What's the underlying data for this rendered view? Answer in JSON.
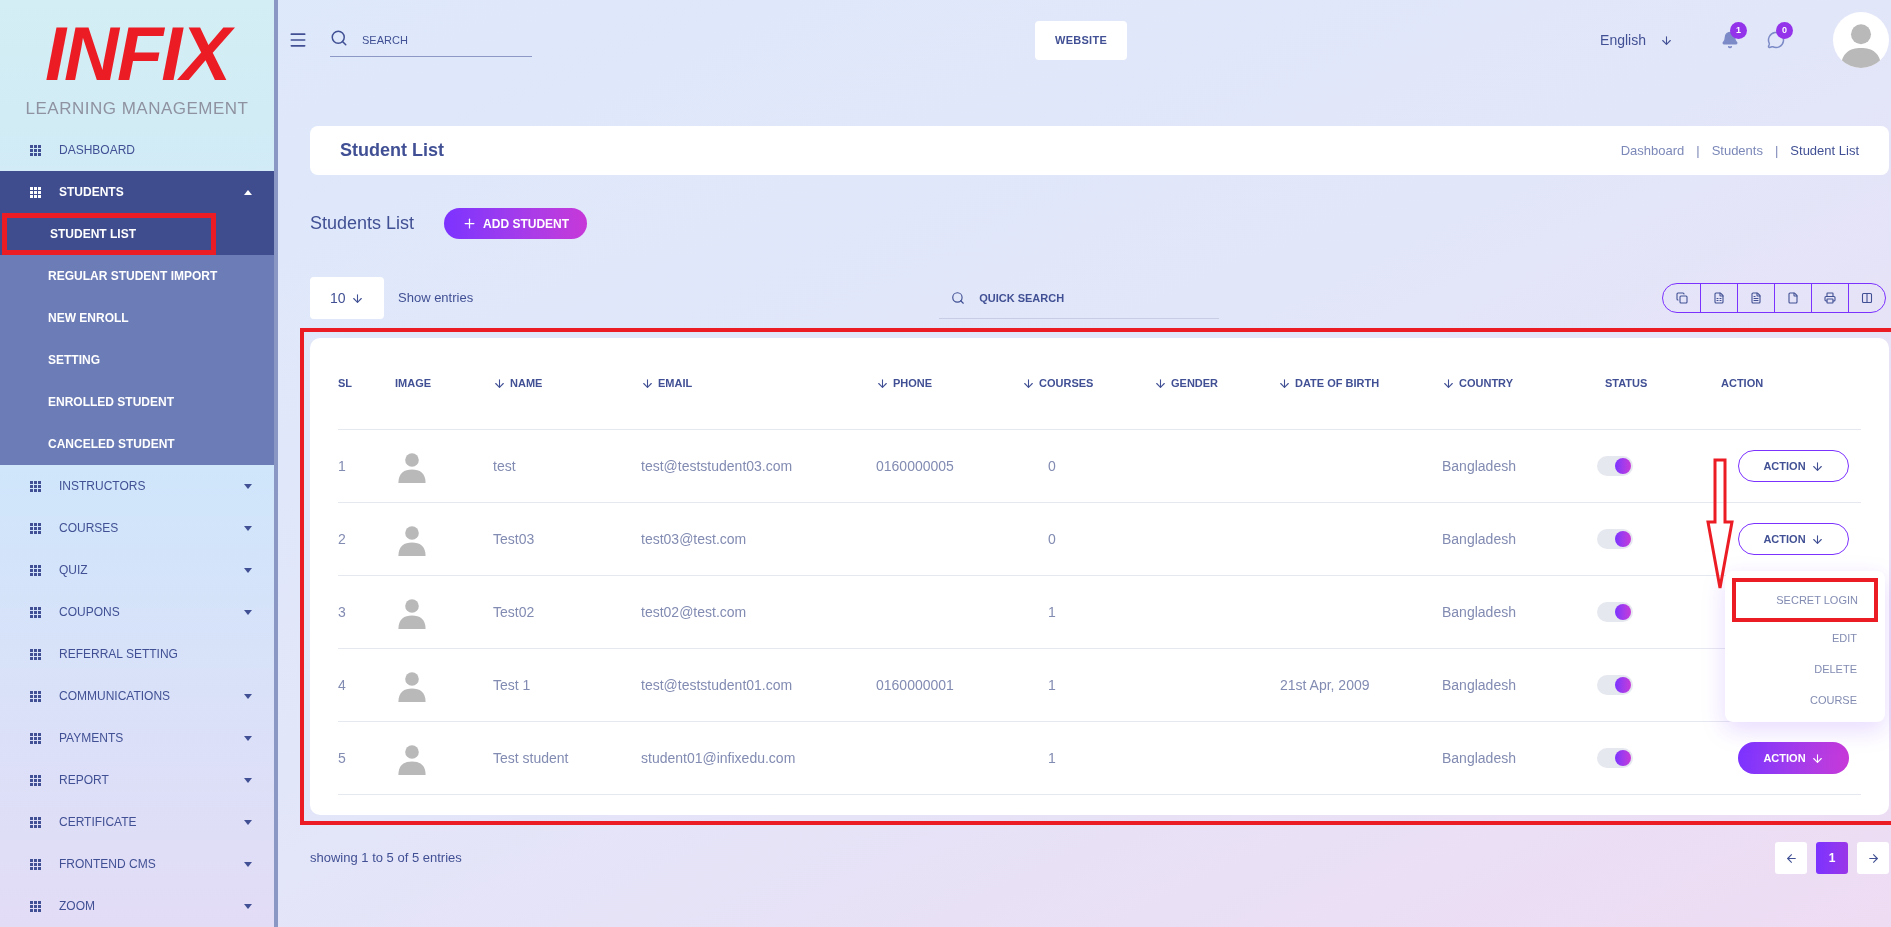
{
  "sidebar": {
    "logo": {
      "word": "INFIX",
      "subtitle": "LEARNING MANAGEMENT"
    },
    "items": [
      {
        "label": "DASHBOARD",
        "selected": false
      },
      {
        "label": "STUDENTS",
        "selected": true,
        "expanded": true,
        "children": [
          {
            "label": "STUDENT LIST",
            "selected": true
          },
          {
            "label": "REGULAR STUDENT IMPORT",
            "selected": false
          },
          {
            "label": "NEW ENROLL",
            "selected": false
          },
          {
            "label": "SETTING",
            "selected": false
          },
          {
            "label": "ENROLLED STUDENT",
            "selected": false
          },
          {
            "label": "CANCELED STUDENT",
            "selected": false
          }
        ]
      },
      {
        "label": "INSTRUCTORS",
        "selected": false,
        "expanded": false
      },
      {
        "label": "COURSES",
        "selected": false,
        "expanded": false
      },
      {
        "label": "QUIZ",
        "selected": false,
        "expanded": false
      },
      {
        "label": "COUPONS",
        "selected": false,
        "expanded": false
      },
      {
        "label": "REFERRAL SETTING",
        "selected": false
      },
      {
        "label": "COMMUNICATIONS",
        "selected": false,
        "expanded": false
      },
      {
        "label": "PAYMENTS",
        "selected": false,
        "expanded": false
      },
      {
        "label": "REPORT",
        "selected": false,
        "expanded": false
      },
      {
        "label": "CERTIFICATE",
        "selected": false,
        "expanded": false
      },
      {
        "label": "FRONTEND CMS",
        "selected": false,
        "expanded": false
      },
      {
        "label": "ZOOM",
        "selected": false,
        "expanded": false
      }
    ]
  },
  "topbar": {
    "search": {
      "placeholder": "SEARCH"
    },
    "website_button": "WEBSITE",
    "language": "English",
    "notifications": {
      "count": "1"
    },
    "messages": {
      "count": "0"
    }
  },
  "page_header": {
    "title": "Student List",
    "breadcrumb": [
      "Dashboard",
      "Students",
      "Student List"
    ],
    "separator": "|"
  },
  "section": {
    "title": "Students List",
    "add_button": "ADD STUDENT"
  },
  "controls": {
    "entries": "10",
    "entries_label": "Show entries",
    "quick_search": {
      "placeholder": "QUICK SEARCH"
    }
  },
  "table": {
    "columns": [
      {
        "label": "SL",
        "sortable": false
      },
      {
        "label": "IMAGE",
        "sortable": false
      },
      {
        "label": "NAME",
        "sortable": true
      },
      {
        "label": "EMAIL",
        "sortable": true
      },
      {
        "label": "PHONE",
        "sortable": true
      },
      {
        "label": "COURSES",
        "sortable": true
      },
      {
        "label": "GENDER",
        "sortable": true
      },
      {
        "label": "DATE OF BIRTH",
        "sortable": true
      },
      {
        "label": "COUNTRY",
        "sortable": true
      },
      {
        "label": "STATUS",
        "sortable": false
      },
      {
        "label": "ACTION",
        "sortable": false
      }
    ],
    "rows": [
      {
        "sl": "1",
        "name": "test",
        "email": "test@teststudent03.com",
        "phone": "0160000005",
        "courses": "0",
        "dob": "",
        "country": "Bangladesh",
        "status_on": true,
        "action": {
          "label": "ACTION",
          "active": false
        }
      },
      {
        "sl": "2",
        "name": "Test03",
        "email": "test03@test.com",
        "phone": "",
        "courses": "0",
        "dob": "",
        "country": "Bangladesh",
        "status_on": true,
        "action": {
          "label": "ACTION",
          "active": false
        }
      },
      {
        "sl": "3",
        "name": "Test02",
        "email": "test02@test.com",
        "phone": "",
        "courses": "1",
        "dob": "",
        "country": "Bangladesh",
        "status_on": true
      },
      {
        "sl": "4",
        "name": "Test 1",
        "email": "test@teststudent01.com",
        "phone": "0160000001",
        "courses": "1",
        "dob": "21st Apr, 2009",
        "country": "Bangladesh",
        "status_on": true
      },
      {
        "sl": "5",
        "name": "Test student",
        "email": "student01@infixedu.com",
        "phone": "",
        "courses": "1",
        "dob": "",
        "country": "Bangladesh",
        "status_on": true,
        "action": {
          "label": "ACTION",
          "active": true
        }
      }
    ],
    "action_menu": [
      "SECRET LOGIN",
      "EDIT",
      "DELETE",
      "COURSE"
    ]
  },
  "footer": {
    "summary": "showing 1 to 5 of 5 entries",
    "pages": [
      {
        "label": "1",
        "selected": true
      }
    ]
  }
}
